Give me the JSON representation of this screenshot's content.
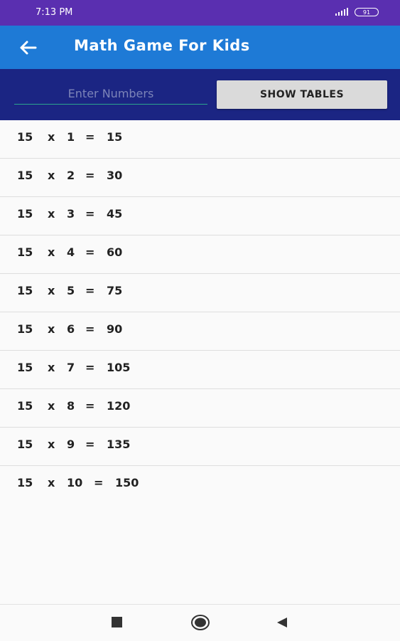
{
  "status_bar": {
    "time": "7:13 PM",
    "battery": "91"
  },
  "app_bar": {
    "title": "Math Game For Kids",
    "back_icon": "arrow-left-icon"
  },
  "input": {
    "placeholder": "Enter Numbers",
    "value": ""
  },
  "show_button": {
    "label": "SHOW TABLES"
  },
  "table_rows": [
    {
      "base": "15",
      "op": "x",
      "multiplier": "1",
      "eq": "=",
      "result": "15"
    },
    {
      "base": "15",
      "op": "x",
      "multiplier": "2",
      "eq": "=",
      "result": "30"
    },
    {
      "base": "15",
      "op": "x",
      "multiplier": "3",
      "eq": "=",
      "result": "45"
    },
    {
      "base": "15",
      "op": "x",
      "multiplier": "4",
      "eq": "=",
      "result": "60"
    },
    {
      "base": "15",
      "op": "x",
      "multiplier": "5",
      "eq": "=",
      "result": "75"
    },
    {
      "base": "15",
      "op": "x",
      "multiplier": "6",
      "eq": "=",
      "result": "90"
    },
    {
      "base": "15",
      "op": "x",
      "multiplier": "7",
      "eq": "=",
      "result": "105"
    },
    {
      "base": "15",
      "op": "x",
      "multiplier": "8",
      "eq": "=",
      "result": "120"
    },
    {
      "base": "15",
      "op": "x",
      "multiplier": "9",
      "eq": "=",
      "result": "135"
    },
    {
      "base": "15",
      "op": "x",
      "multiplier": "10",
      "eq": "=",
      "result": "150"
    }
  ],
  "nav_bar": {
    "icons": [
      "square-recents-icon",
      "circle-home-icon",
      "triangle-back-icon"
    ]
  },
  "colors": {
    "status_bar": "#5a2fb0",
    "app_bar": "#1e7ad6",
    "input_bar": "#1b2583",
    "input_underline": "#2ca58d",
    "button": "#dadada"
  }
}
